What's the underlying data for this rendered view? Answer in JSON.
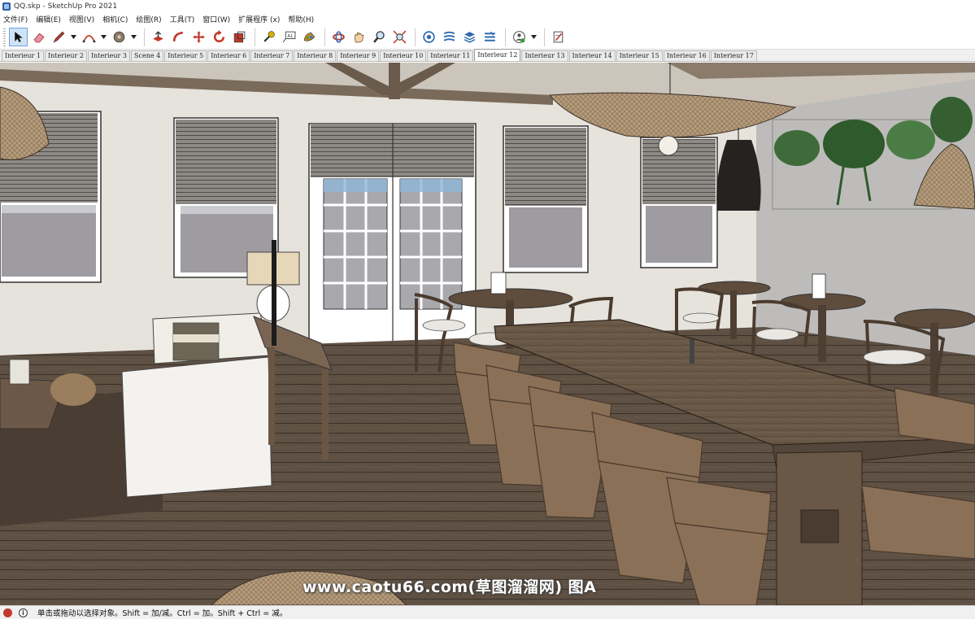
{
  "window": {
    "title": "QQ.skp - SketchUp Pro 2021"
  },
  "menu": {
    "items": [
      "文件(F)",
      "编辑(E)",
      "视图(V)",
      "相机(C)",
      "绘图(R)",
      "工具(T)",
      "窗口(W)",
      "扩展程序 (x)",
      "帮助(H)"
    ]
  },
  "toolbar": {
    "tools": [
      "select-icon",
      "eraser-icon",
      "pencil-icon",
      "arc-icon",
      "paint-bucket-icon",
      "push-pull-icon",
      "follow-me-icon",
      "move-icon",
      "rotate-icon",
      "scale-icon",
      "tape-measure-icon",
      "text-label-icon",
      "paint-icon",
      "orbit-icon",
      "pan-icon",
      "zoom-icon",
      "zoom-extents-icon",
      "warehouse-icon",
      "components-icon",
      "layers-icon",
      "extensions-icon",
      "sections-icon",
      "profile-icon",
      "notes-icon"
    ]
  },
  "scenes": {
    "tabs": [
      "Interieur 1",
      "Interieur 2",
      "Interieur 3",
      "Scene 4",
      "Interieur 5",
      "Interieur 6",
      "Interieur 7",
      "Interieur 8",
      "Interieur 9",
      "Interieur 10",
      "Interieur 11",
      "Interieur 12",
      "Interieur 13",
      "Interieur 14",
      "Interieur 15",
      "Interieur 16",
      "Interieur 17"
    ],
    "active_index": 11
  },
  "viewport": {
    "watermark": "www.caotu66.com(草图溜溜网) 图A"
  },
  "status": {
    "message": "单击或拖动以选择对象。Shift = 加/减。Ctrl = 加。Shift + Ctrl = 减。"
  },
  "colors": {
    "active_tab": "#ffffff",
    "toolbar_select_highlight": "#cfe3f7",
    "wall": "#e4e0d8",
    "floor": "#5a4c3e",
    "wood_table": "#5b4a3a"
  }
}
